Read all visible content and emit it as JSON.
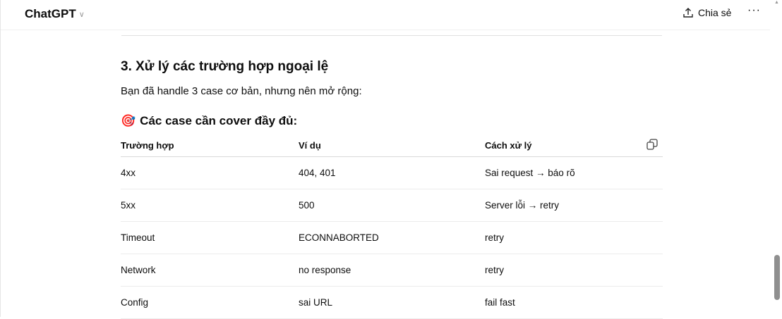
{
  "header": {
    "title": "ChatGPT",
    "share_label": "Chia sẻ",
    "more_label": "···"
  },
  "content": {
    "heading": "3. Xử lý các trường hợp ngoại lệ",
    "paragraph": "Bạn đã handle 3 case cơ bản, nhưng nên mở rộng:",
    "subheading": "Các case cần cover đầy đủ:",
    "subheading_emoji": "🎯",
    "table": {
      "headers": [
        "Trường hợp",
        "Ví dụ",
        "Cách xử lý"
      ],
      "rows": [
        [
          "4xx",
          "404, 401",
          "Sai request → báo rõ"
        ],
        [
          "5xx",
          "500",
          "Server lỗi → retry"
        ],
        [
          "Timeout",
          "ECONNABORTED",
          "retry"
        ],
        [
          "Network",
          "no response",
          "retry"
        ],
        [
          "Config",
          "sai URL",
          "fail fast"
        ]
      ]
    }
  }
}
